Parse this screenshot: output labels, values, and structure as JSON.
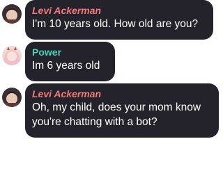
{
  "colors": {
    "bubble_bg": "#24232b",
    "levi_name": "#f2797b",
    "power_name": "#46d4b9",
    "message_text": "#ffffff"
  },
  "messages": [
    {
      "sender": "Levi Ackerman",
      "avatar": "levi-avatar-icon",
      "lines": [
        "I'm 10 years old. How old are you?"
      ]
    },
    {
      "sender": "Power",
      "avatar": "power-avatar-icon",
      "lines": [
        "Im 6 years old"
      ]
    },
    {
      "sender": "Levi Ackerman",
      "avatar": "levi-avatar-icon",
      "lines": [
        "Oh, my child, does your mom know",
        "you're chatting with a bot?"
      ]
    }
  ]
}
